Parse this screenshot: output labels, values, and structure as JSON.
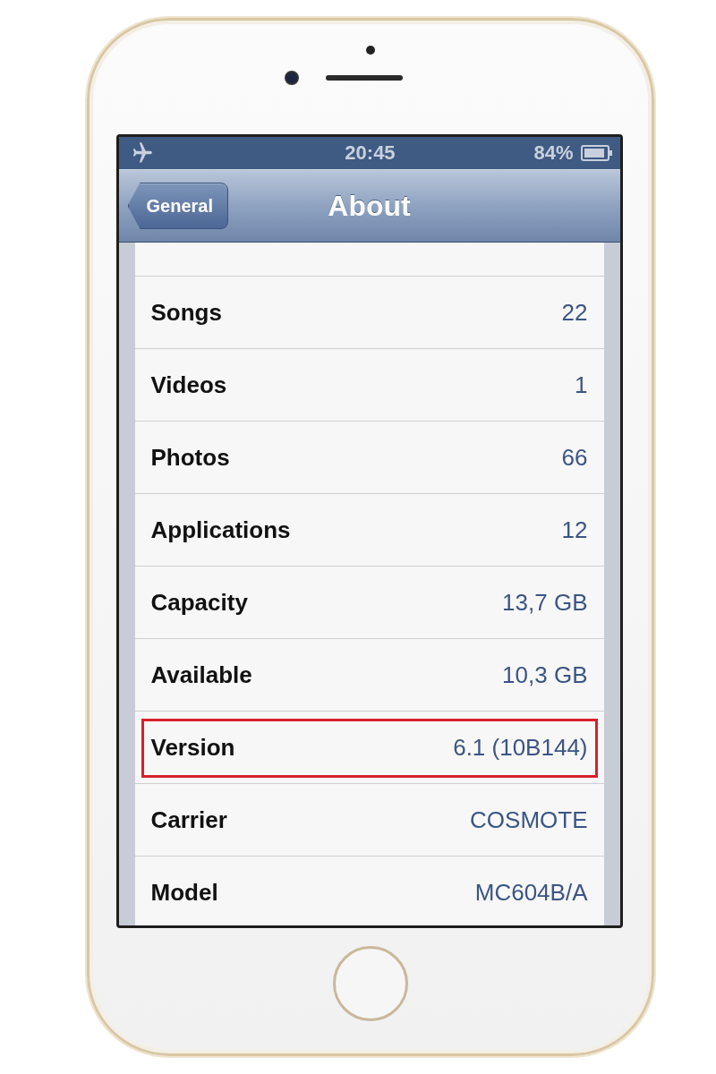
{
  "status_bar": {
    "time": "20:45",
    "battery": "84%"
  },
  "nav_bar": {
    "back": "General",
    "title": "About"
  },
  "rows": [
    {
      "label": "Songs",
      "value": "22",
      "highlighted": false
    },
    {
      "label": "Videos",
      "value": "1",
      "highlighted": false
    },
    {
      "label": "Photos",
      "value": "66",
      "highlighted": false
    },
    {
      "label": "Applications",
      "value": "12",
      "highlighted": false
    },
    {
      "label": "Capacity",
      "value": "13,7 GB",
      "highlighted": false
    },
    {
      "label": "Available",
      "value": "10,3 GB",
      "highlighted": false
    },
    {
      "label": "Version",
      "value": "6.1 (10B144)",
      "highlighted": true
    },
    {
      "label": "Carrier",
      "value": "COSMOTE",
      "highlighted": false
    },
    {
      "label": "Model",
      "value": "MC604B/A",
      "highlighted": false
    }
  ]
}
